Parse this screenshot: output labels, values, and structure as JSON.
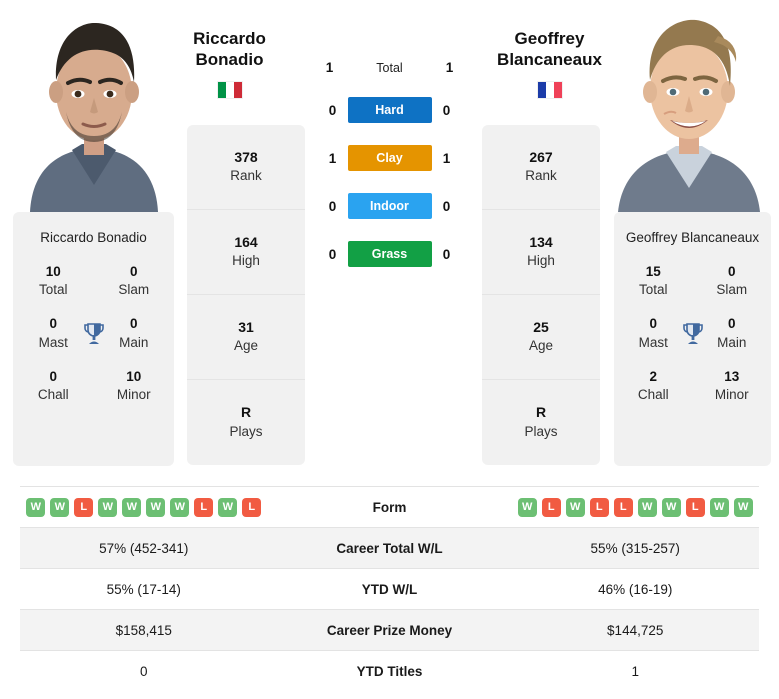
{
  "players": {
    "left": {
      "first_name": "Riccardo",
      "last_name": "Bonadio",
      "full_name": "Riccardo Bonadio",
      "country": "Italy",
      "flag_icon": "flag-italy",
      "flag_colors": [
        "#009246",
        "#ffffff",
        "#ce2b37"
      ],
      "ranks": [
        {
          "value": "378",
          "label": "Rank"
        },
        {
          "value": "164",
          "label": "High"
        },
        {
          "value": "31",
          "label": "Age"
        },
        {
          "value": "R",
          "label": "Plays"
        }
      ],
      "titles": [
        {
          "value": "10",
          "label": "Total"
        },
        {
          "value": "0",
          "label": "Slam"
        },
        {
          "value": "0",
          "label": "Mast"
        },
        {
          "value": "0",
          "label": "Main"
        },
        {
          "value": "0",
          "label": "Chall"
        },
        {
          "value": "10",
          "label": "Minor"
        }
      ],
      "form": [
        "W",
        "W",
        "L",
        "W",
        "W",
        "W",
        "W",
        "L",
        "W",
        "L"
      ],
      "career_total_wl": "57% (452-341)",
      "ytd_wl": "55% (17-14)",
      "career_prize_money": "$158,415",
      "ytd_titles": "0"
    },
    "right": {
      "first_name": "Geoffrey",
      "last_name": "Blancaneaux",
      "full_name": "Geoffrey Blancaneaux",
      "country": "France",
      "flag_icon": "flag-france",
      "flag_colors": [
        "#1c3ca8",
        "#ffffff",
        "#ef4158"
      ],
      "ranks": [
        {
          "value": "267",
          "label": "Rank"
        },
        {
          "value": "134",
          "label": "High"
        },
        {
          "value": "25",
          "label": "Age"
        },
        {
          "value": "R",
          "label": "Plays"
        }
      ],
      "titles": [
        {
          "value": "15",
          "label": "Total"
        },
        {
          "value": "0",
          "label": "Slam"
        },
        {
          "value": "0",
          "label": "Mast"
        },
        {
          "value": "0",
          "label": "Main"
        },
        {
          "value": "2",
          "label": "Chall"
        },
        {
          "value": "13",
          "label": "Minor"
        }
      ],
      "form": [
        "W",
        "L",
        "W",
        "L",
        "L",
        "W",
        "W",
        "L",
        "W",
        "W"
      ],
      "career_total_wl": "55% (315-257)",
      "ytd_wl": "46% (16-19)",
      "career_prize_money": "$144,725",
      "ytd_titles": "1"
    }
  },
  "head_to_head": [
    {
      "label": "Total",
      "left": "1",
      "right": "1",
      "style": "plain",
      "color": ""
    },
    {
      "label": "Hard",
      "left": "0",
      "right": "0",
      "style": "surface",
      "color": "#0e72c4"
    },
    {
      "label": "Clay",
      "left": "1",
      "right": "1",
      "style": "surface",
      "color": "#e59400"
    },
    {
      "label": "Indoor",
      "left": "0",
      "right": "0",
      "style": "surface",
      "color": "#2aa3f0"
    },
    {
      "label": "Grass",
      "left": "0",
      "right": "0",
      "style": "surface",
      "color": "#12a045"
    }
  ],
  "stats_rows": [
    {
      "label": "Form",
      "left": "",
      "right": "",
      "type": "form"
    },
    {
      "label": "Career Total W/L",
      "left": "57% (452-341)",
      "right": "55% (315-257)",
      "type": "text"
    },
    {
      "label": "YTD W/L",
      "left": "55% (17-14)",
      "right": "46% (16-19)",
      "type": "text"
    },
    {
      "label": "Career Prize Money",
      "left": "$158,415",
      "right": "$144,725",
      "type": "text"
    },
    {
      "label": "YTD Titles",
      "left": "0",
      "right": "1",
      "type": "text"
    }
  ],
  "icons": {
    "trophy": "trophy-icon"
  },
  "colors": {
    "badge_win": "#6cbf73",
    "badge_loss": "#f15b42",
    "card_bg": "#f1f1f1",
    "row_shade": "#f3f3f3"
  }
}
